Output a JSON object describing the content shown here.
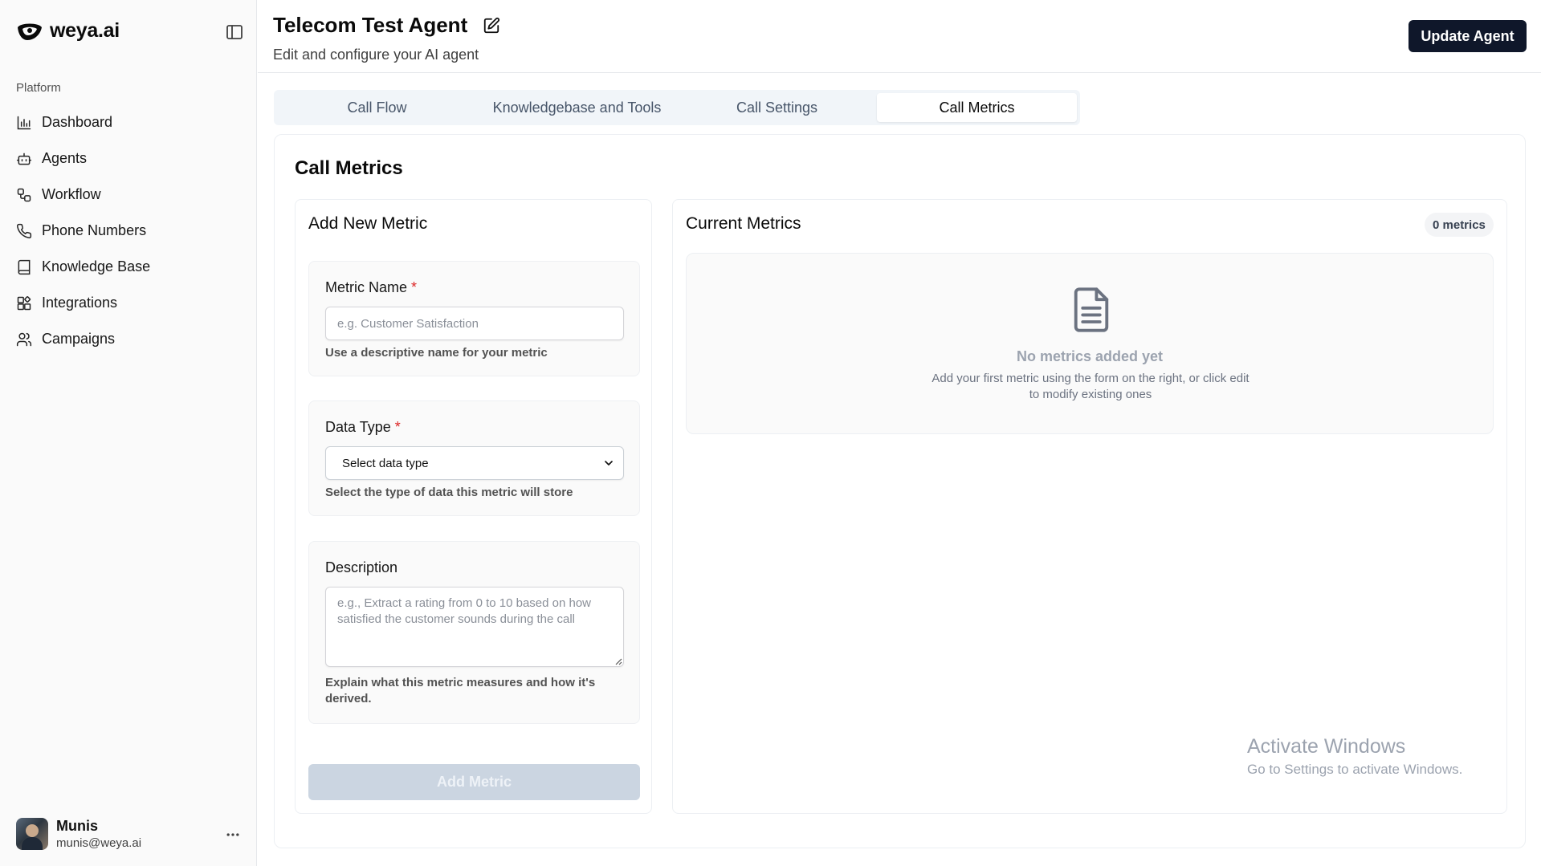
{
  "brand": {
    "name": "weya.ai"
  },
  "sidebar": {
    "section_label": "Platform",
    "items": [
      {
        "label": "Dashboard",
        "icon": "bar-chart-icon"
      },
      {
        "label": "Agents",
        "icon": "bot-icon"
      },
      {
        "label": "Workflow",
        "icon": "workflow-icon"
      },
      {
        "label": "Phone Numbers",
        "icon": "phone-icon"
      },
      {
        "label": "Knowledge Base",
        "icon": "book-icon"
      },
      {
        "label": "Integrations",
        "icon": "blocks-icon"
      },
      {
        "label": "Campaigns",
        "icon": "users-icon"
      }
    ],
    "user": {
      "name": "Munis",
      "email": "munis@weya.ai"
    }
  },
  "header": {
    "title": "Telecom Test Agent",
    "subtitle": "Edit and configure your AI agent",
    "update_label": "Update Agent"
  },
  "tabs": [
    {
      "label": "Call Flow",
      "active": false
    },
    {
      "label": "Knowledgebase and Tools",
      "active": false
    },
    {
      "label": "Call Settings",
      "active": false
    },
    {
      "label": "Call Metrics",
      "active": true
    }
  ],
  "main": {
    "title": "Call Metrics",
    "form": {
      "title": "Add New Metric",
      "metric_name": {
        "label": "Metric Name",
        "required_mark": "*",
        "value": "",
        "placeholder": "e.g. Customer Satisfaction",
        "help": "Use a descriptive name for your metric"
      },
      "data_type": {
        "label": "Data Type",
        "required_mark": "*",
        "selected": "Select data type",
        "help": "Select the type of data this metric will store"
      },
      "description": {
        "label": "Description",
        "value": "",
        "placeholder": "e.g., Extract a rating from 0 to 10 based on how satisfied the customer sounds during the call",
        "help": "Explain what this metric measures and how it's derived."
      },
      "submit_label": "Add Metric"
    },
    "current": {
      "title": "Current Metrics",
      "count_label": "0 metrics",
      "empty_title": "No metrics added yet",
      "empty_desc": "Add your first metric using the form on the right, or click edit to modify existing ones"
    }
  },
  "watermark": {
    "title": "Activate Windows",
    "subtitle": "Go to Settings to activate Windows."
  },
  "colors": {
    "primary": "#0f172a",
    "required": "#dc2626",
    "disabled_button": "#cbd5e1",
    "sidebar_bg": "#fafafa"
  }
}
